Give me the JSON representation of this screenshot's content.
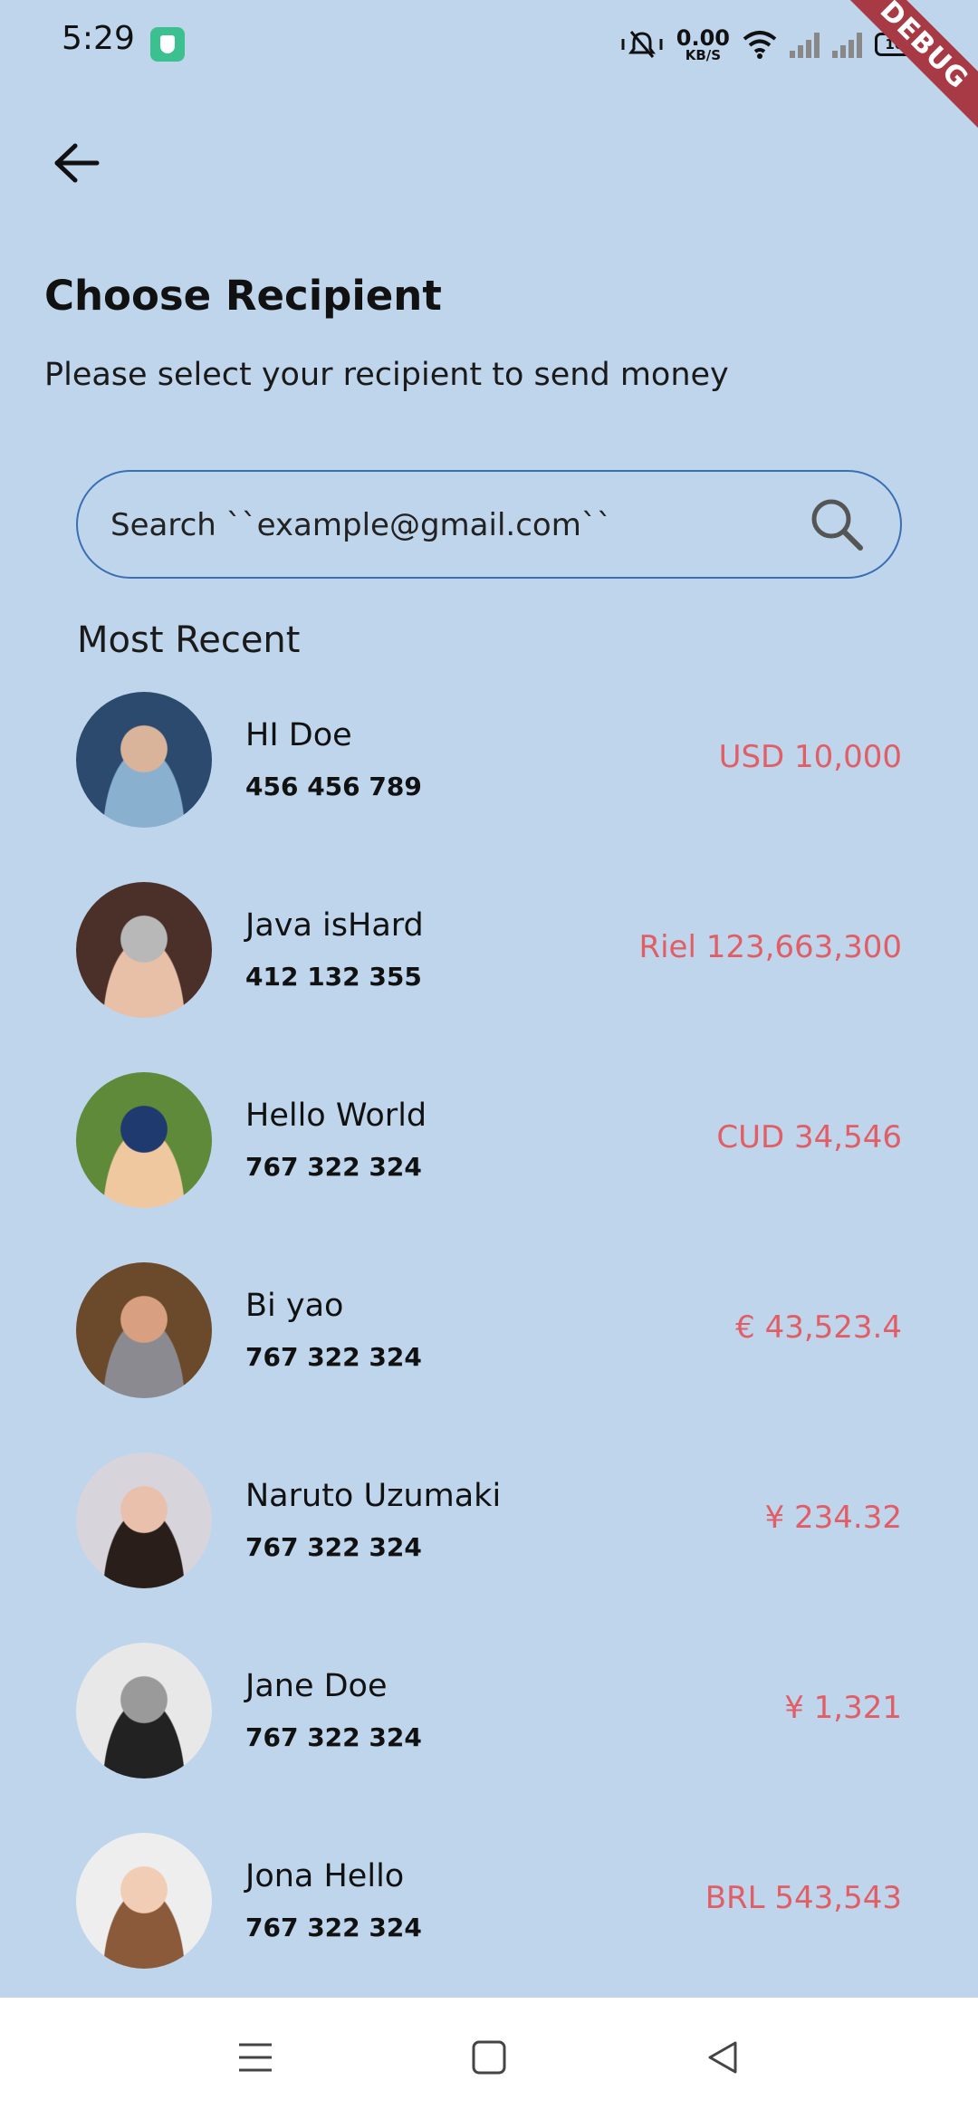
{
  "status_bar": {
    "time": "5:29",
    "net_speed_value": "0.00",
    "net_speed_unit": "KB/S",
    "battery": "100",
    "debug_label": "DEBUG",
    "icons": [
      "app-shield-icon",
      "bell-muted-icon",
      "wifi-icon",
      "signal-icon",
      "signal-icon",
      "battery-icon"
    ]
  },
  "header": {
    "back_icon": "arrow-left-icon",
    "title": "Choose Recipient",
    "subtitle": "Please select your recipient to send money"
  },
  "search": {
    "placeholder": "Search ``example@gmail.com``",
    "value": "",
    "icon": "search-icon"
  },
  "section": {
    "title": "Most Recent"
  },
  "recipients": [
    {
      "name": "HI Doe",
      "number": "456 456 789",
      "amount": "USD 10,000",
      "avatar_colors": [
        "#2c4a6e",
        "#8ab0d0",
        "#d9b39a"
      ]
    },
    {
      "name": "Java isHard",
      "number": "412 132 355",
      "amount": "Riel 123,663,300",
      "avatar_colors": [
        "#4a3028",
        "#e8c0a8",
        "#b8b8b8"
      ]
    },
    {
      "name": "Hello World",
      "number": "767 322 324",
      "amount": "CUD 34,546",
      "avatar_colors": [
        "#5e8a3a",
        "#f0c8a0",
        "#1f3a6e"
      ]
    },
    {
      "name": "Bi yao",
      "number": "767 322 324",
      "amount": "€ 43,523.4",
      "avatar_colors": [
        "#6a4a2a",
        "#8a8a90",
        "#d8a080"
      ]
    },
    {
      "name": "Naruto Uzumaki",
      "number": "767 322 324",
      "amount": "¥ 234.32",
      "avatar_colors": [
        "#d8d4dc",
        "#2a1e1a",
        "#e8c0ac"
      ]
    },
    {
      "name": "Jane Doe",
      "number": "767 322 324",
      "amount": "¥ 1,321",
      "avatar_colors": [
        "#e8e8e8",
        "#222222",
        "#9a9a9a"
      ]
    },
    {
      "name": "Jona Hello",
      "number": "767 322 324",
      "amount": "BRL 543,543",
      "avatar_colors": [
        "#eeeeee",
        "#8a5a3a",
        "#f0cdb4"
      ]
    }
  ],
  "nav_bar": {
    "icons": [
      "menu-icon",
      "home-square-icon",
      "back-triangle-icon"
    ]
  },
  "colors": {
    "background": "#bed5ec",
    "amount": "#e25e66",
    "search_border": "#3a6fb5"
  }
}
